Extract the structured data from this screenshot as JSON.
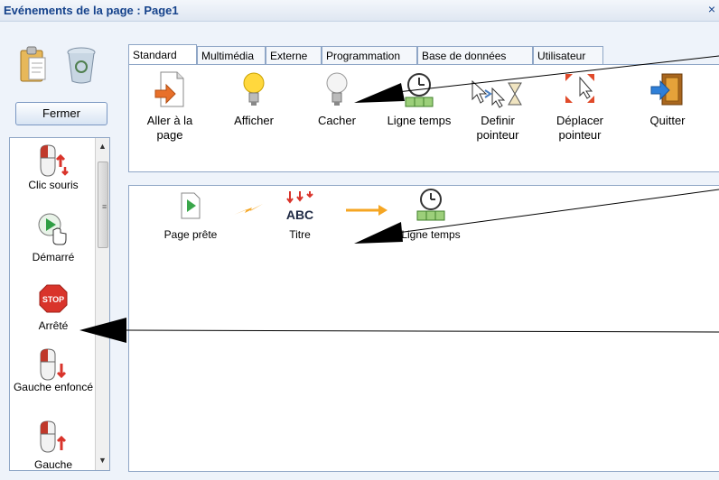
{
  "window": {
    "title": "Evénements de la page : Page1",
    "close_glyph": "×"
  },
  "left": {
    "fermer_label": "Fermer",
    "events": [
      {
        "label": "Clic souris",
        "icon": "mouse-click-icon"
      },
      {
        "label": "Démarré",
        "icon": "play-cursor-icon"
      },
      {
        "label": "Arrêté",
        "icon": "stop-sign-icon"
      },
      {
        "label": "Gauche enfoncé",
        "icon": "mouse-left-down-icon"
      },
      {
        "label": "Gauche",
        "icon": "mouse-left-up-icon"
      }
    ],
    "stop_text": "STOP"
  },
  "tabs": [
    "Standard",
    "Multimédia",
    "Externe",
    "Programmation",
    "Base de données",
    "Utilisateur"
  ],
  "active_tab": "Standard",
  "tools": [
    {
      "label": "Aller à la page",
      "icon": "goto-page-icon"
    },
    {
      "label": "Afficher",
      "icon": "lightbulb-on-icon"
    },
    {
      "label": "Cacher",
      "icon": "lightbulb-off-icon"
    },
    {
      "label": "Ligne temps",
      "icon": "timeline-icon"
    },
    {
      "label": "Definir pointeur",
      "icon": "set-pointer-icon"
    },
    {
      "label": "Déplacer pointeur",
      "icon": "move-pointer-icon"
    },
    {
      "label": "Quitter",
      "icon": "exit-door-icon"
    }
  ],
  "flow": {
    "nodes": [
      {
        "label": "Page prête",
        "icon": "page-ready-icon"
      },
      {
        "label": "Titre",
        "icon": "title-abc-icon"
      },
      {
        "label": "Ligne temps",
        "icon": "timeline-icon"
      }
    ],
    "title_glyphs": "ABC"
  },
  "colors": {
    "title": "#15428b",
    "border": "#8fa6c6",
    "arrow_orange": "#f5a623",
    "stop_red": "#d9342b"
  }
}
